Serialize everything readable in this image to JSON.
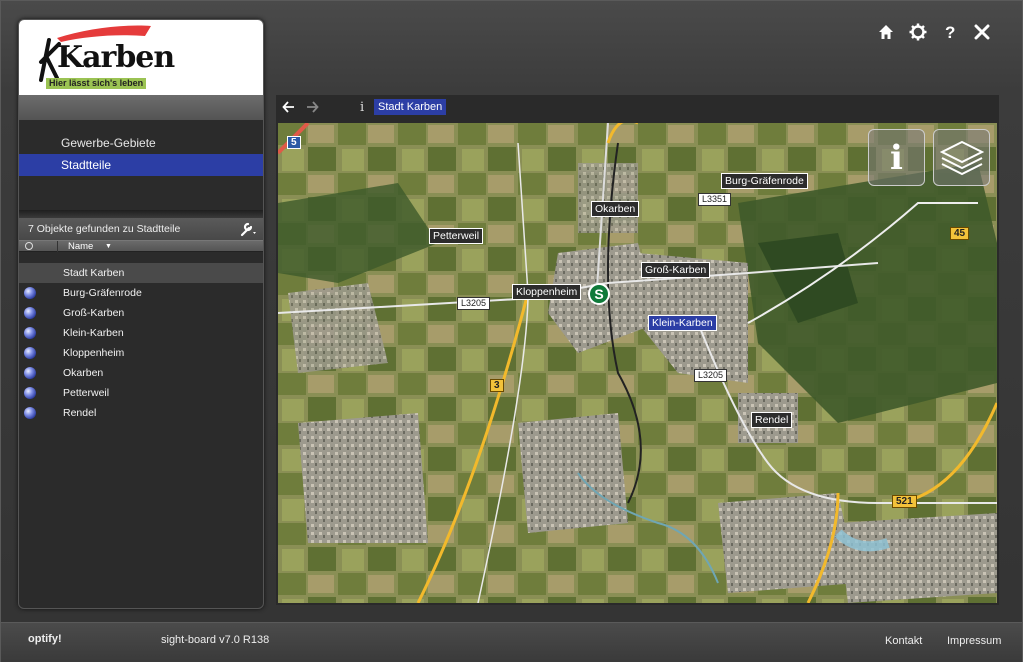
{
  "logo": {
    "wordmark": "Karben",
    "slogan": "Hier lässt sich's leben"
  },
  "top_icons": [
    "home-icon",
    "gear-icon",
    "help-icon",
    "close-icon"
  ],
  "categories": [
    {
      "label": "Gewerbe-Gebiete",
      "active": false
    },
    {
      "label": "Stadtteile",
      "active": true
    }
  ],
  "results": {
    "summary": "7 Objekte gefunden zu Stadtteile",
    "column_name": "Name",
    "group_header": "Stadt Karben",
    "items": [
      "Burg-Gräfenrode",
      "Groß-Karben",
      "Klein-Karben",
      "Kloppenheim",
      "Okarben",
      "Petterweil",
      "Rendel"
    ]
  },
  "map_toolbar": {
    "info": "i",
    "breadcrumb": "Stadt Karben"
  },
  "map": {
    "labels": {
      "burg": "Burg-Gräfenrode",
      "okarben": "Okarben",
      "petterweil": "Petterweil",
      "gross": "Groß-Karben",
      "kloppenheim": "Kloppenheim",
      "klein": "Klein-Karben",
      "rendel": "Rendel"
    },
    "roads": {
      "r5": "5",
      "l3351": "L3351",
      "r45": "45",
      "l3205a": "L3205",
      "r3": "3",
      "l3205b": "L3205",
      "r521": "521"
    },
    "sbahn": "S",
    "info_button": "i"
  },
  "footer": {
    "brand": "optify!",
    "version": "sight-board v7.0 R138",
    "kontakt": "Kontakt",
    "impressum": "Impressum"
  }
}
